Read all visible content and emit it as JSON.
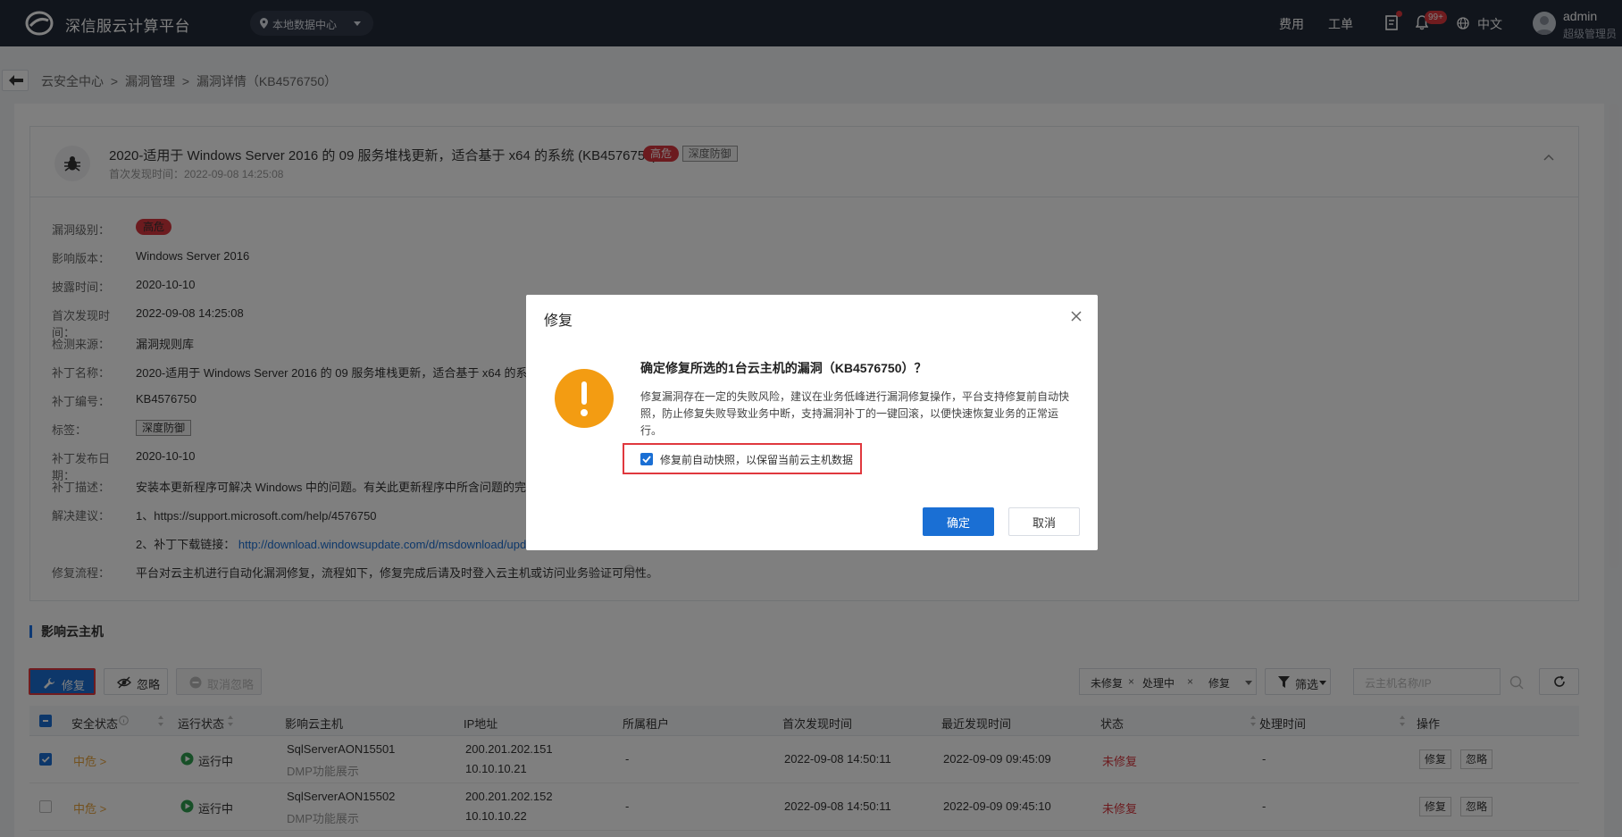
{
  "topbar": {
    "brand": "深信服云计算平台",
    "datacenter": "本地数据中心",
    "links": {
      "fees": "费用",
      "tickets": "工单"
    },
    "notify_badge": "99+",
    "language": "中文",
    "user_name": "admin",
    "user_role": "超级管理员"
  },
  "breadcrumb": {
    "items": [
      "云安全中心",
      ">",
      "漏洞管理",
      ">",
      "漏洞详情（KB4576750）"
    ]
  },
  "detail": {
    "title": "2020-适用于 Windows Server 2016 的 09 服务堆栈更新，适合基于 x64 的系统 (KB4576750)",
    "tag_level": "高危",
    "tag_defense": "深度防御",
    "first_found": "首次发现时间：2022-09-08 14:25:08",
    "fields": [
      {
        "key": "漏洞级别：",
        "value": "高危"
      },
      {
        "key": "影响版本：",
        "value": "Windows Server 2016"
      },
      {
        "key": "披露时间：",
        "value": "2020-10-10"
      },
      {
        "key": "首次发现时间：",
        "value": "2022-09-08 14:25:08"
      },
      {
        "key": "检测来源：",
        "value": "漏洞规则库"
      },
      {
        "key": "补丁名称：",
        "value": "2020-适用于 Windows Server 2016 的 09 服务堆栈更新，适合基于 x64 的系统（"
      },
      {
        "key": "补丁编号：",
        "value": "KB4576750"
      },
      {
        "key": "标签：",
        "value": "深度防御"
      },
      {
        "key": "补丁发布日期：",
        "value": "2020-10-10"
      },
      {
        "key": "补丁描述：",
        "value": "安装本更新程序可解决 Windows 中的问题。有关此更新程序中所含问题的完整列表"
      },
      {
        "key": "解决建议：",
        "value": "1、https://support.microsoft.com/help/4576750"
      },
      {
        "key": "",
        "value": "2、补丁下载链接：",
        "link": "http://download.windowsupdate.com/d/msdownload/upd"
      },
      {
        "key": "修复流程：",
        "value": "平台对云主机进行自动化漏洞修复，流程如下，修复完成后请及时登入云主机或访问业务验证可用性。"
      }
    ]
  },
  "hosts": {
    "section_title": "影响云主机",
    "toolbar": {
      "repair": "修复",
      "ignore": "忽略",
      "cancel_ignore": "取消忽略",
      "filter_tags": [
        "未修复",
        "处理中",
        "修复"
      ],
      "filter": "筛选",
      "search_placeholder": "云主机名称/IP"
    },
    "columns": [
      "安全状态",
      "运行状态",
      "影响云主机",
      "IP地址",
      "所属租户",
      "首次发现时间",
      "最近发现时间",
      "状态",
      "处理时间",
      "操作"
    ],
    "rows": [
      {
        "checked": true,
        "security": "中危 >",
        "run_state": "运行中",
        "host": "SqlServerAON15501",
        "host_desc": "DMP功能展示",
        "ip1": "200.201.202.151",
        "ip2": "10.10.10.21",
        "tenant": "-",
        "first": "2022-09-08 14:50:11",
        "last": "2022-09-09 09:45:09",
        "status": "未修复",
        "handled": "-",
        "op_repair": "修复",
        "op_ignore": "忽略"
      },
      {
        "checked": false,
        "security": "中危 >",
        "run_state": "运行中",
        "host": "SqlServerAON15502",
        "host_desc": "DMP功能展示",
        "ip1": "200.201.202.152",
        "ip2": "10.10.10.22",
        "tenant": "-",
        "first": "2022-09-08 14:50:11",
        "last": "2022-09-09 09:45:10",
        "status": "未修复",
        "handled": "-",
        "op_repair": "修复",
        "op_ignore": "忽略"
      }
    ]
  },
  "modal": {
    "title": "修复",
    "question": "确定修复所选的1台云主机的漏洞（KB4576750）？",
    "description": "修复漏洞存在一定的失败风险，建议在业务低峰进行漏洞修复操作，平台支持修复前自动快照，防止修复失败导致业务中断，支持漏洞补丁的一键回滚，以便快速恢复业务的正常运行。",
    "checkbox_label": "修复前自动快照，以保留当前云主机数据",
    "checkbox_checked": true,
    "ok": "确定",
    "cancel": "取消"
  },
  "colors": {
    "topbar": "#232a38",
    "primary": "#1a6fd4",
    "danger": "#d9363e",
    "warning": "#f39c12"
  }
}
